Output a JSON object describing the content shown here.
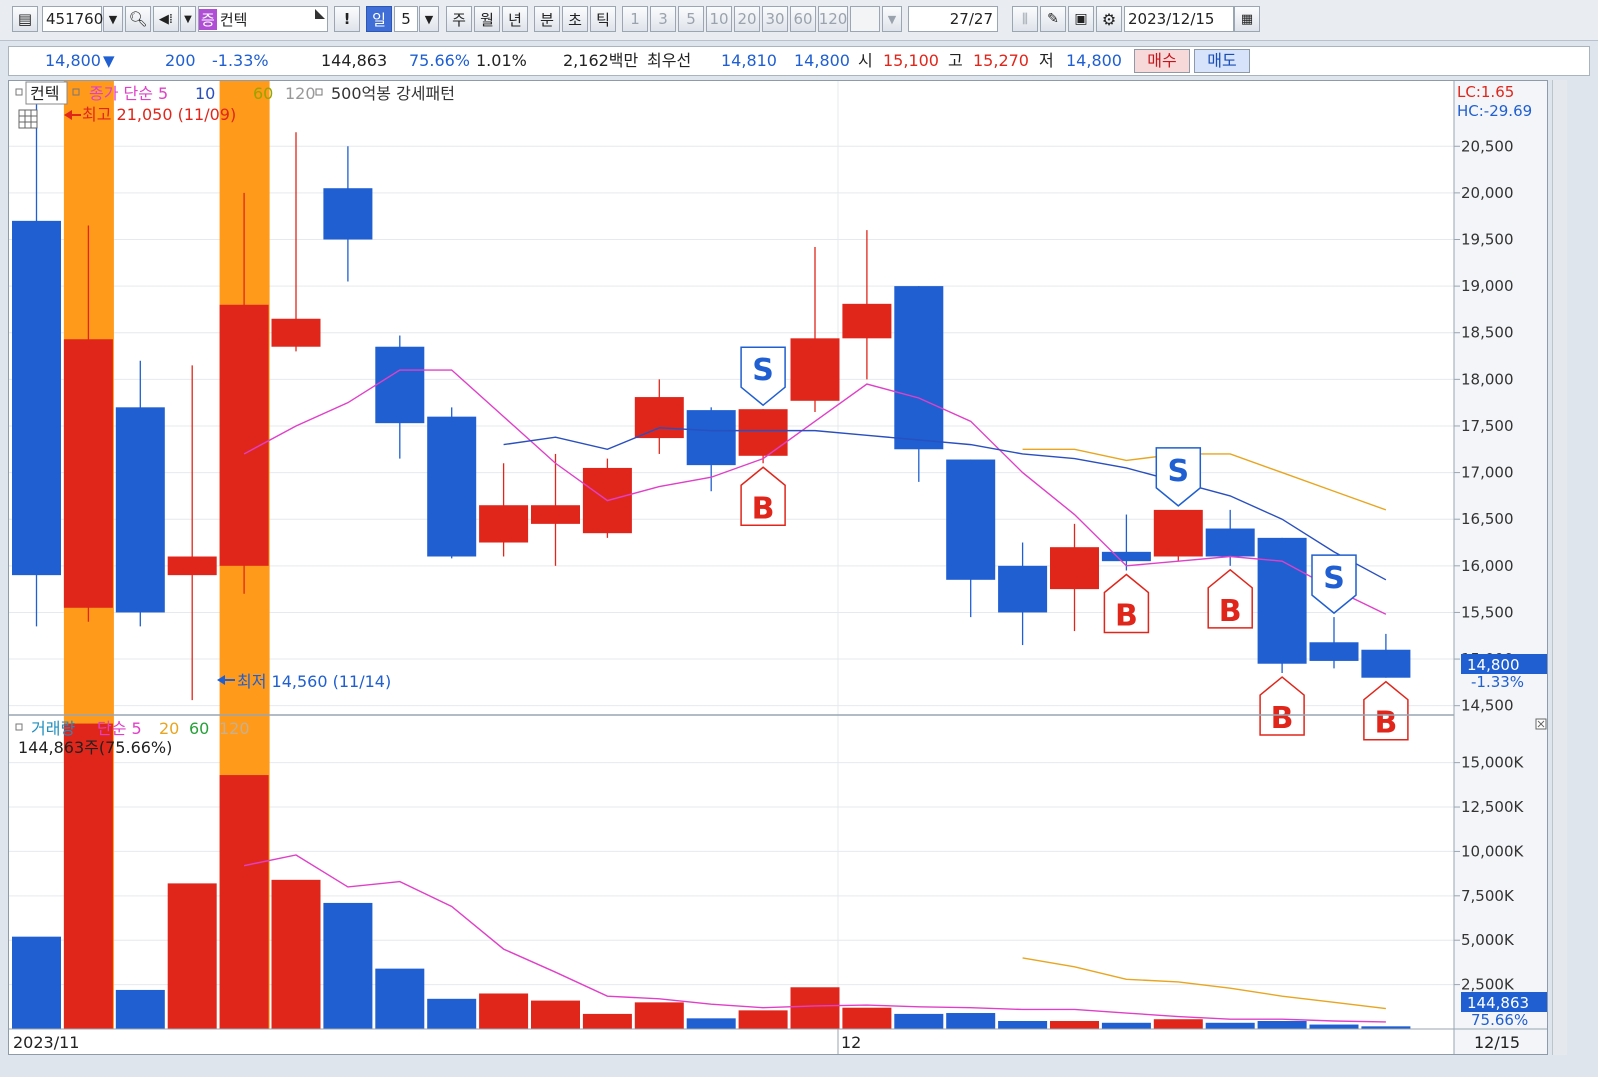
{
  "toolbar": {
    "code": "451760",
    "stock_name": "컨텍",
    "badge": "증",
    "alert": "!",
    "period_day": "일",
    "period_value": "5",
    "period_week": "주",
    "period_month": "월",
    "period_year": "년",
    "period_minute": "분",
    "period_second": "초",
    "period_tick": "틱",
    "intervals": [
      "1",
      "3",
      "5",
      "10",
      "20",
      "30",
      "60",
      "120"
    ],
    "page": "27/27",
    "date": "2023/12/15",
    "icons": [
      "search-icon",
      "speaker-icon",
      "chevron-down-icon",
      "bars-icon",
      "pencil-icon",
      "save-icon",
      "gear-icon",
      "calendar-icon"
    ]
  },
  "quote": {
    "price": "14,800",
    "arrow": "▼",
    "change": "200",
    "change_pct": "-1.33%",
    "volume": "144,863",
    "vol_ratio": "75.66%",
    "turnover": "1.01%",
    "amount": "2,162백만",
    "best_label": "최우선",
    "best_ask": "14,810",
    "best_bid": "14,800",
    "open_label": "시",
    "open": "15,100",
    "high_label": "고",
    "high": "15,270",
    "low_label": "저",
    "low": "14,800",
    "buy_label": "매수",
    "sell_label": "매도"
  },
  "price_panel": {
    "legend_name": "컨텍",
    "legend_ma": "종가 단순 5",
    "legend_10": "10",
    "legend_60": "60",
    "legend_120": "120",
    "legend_pattern": "500억봉 강세패턴",
    "max_label": "최고 21,050 (11/09)",
    "min_label": "최저 14,560 (11/14)",
    "lc_label": "LC:1.65",
    "hc_label": "HC:-29.69",
    "current_price": "14,800",
    "current_pct": "-1.33%",
    "y_ticks": [
      "20,500",
      "20,000",
      "19,500",
      "19,000",
      "18,500",
      "18,000",
      "17,500",
      "17,000",
      "16,500",
      "16,000",
      "15,500",
      "15,000",
      "14,500"
    ]
  },
  "volume_panel": {
    "legend_name": "거래량",
    "legend_ma": "단순 5",
    "legend_20": "20",
    "legend_60": "60",
    "legend_120": "120",
    "vol_label": "144,863주(75.66%)",
    "current_volume": "144,863",
    "current_pct": "75.66%",
    "y_ticks": [
      "15,000K",
      "12,500K",
      "10,000K",
      "7,500K",
      "5,000K",
      "2,500K"
    ]
  },
  "x_axis": {
    "start": "2023/11",
    "mid": "12",
    "end": "12/15"
  },
  "colors": {
    "up": "#e0261b",
    "down": "#1f5fd1",
    "highlight": "#ff9a1a",
    "ma5": "#e040c8",
    "ma10": "#2a4fbf",
    "ma20": "#e8a520"
  },
  "chart_data": {
    "type": "candlestick",
    "candles": [
      {
        "o": 19700,
        "c": 15900,
        "h": 21050,
        "l": 15350
      },
      {
        "o": 15550,
        "c": 18430,
        "h": 19650,
        "l": 15400
      },
      {
        "o": 17700,
        "c": 15500,
        "h": 18200,
        "l": 15350
      },
      {
        "o": 15900,
        "c": 16100,
        "h": 18150,
        "l": 14560
      },
      {
        "o": 16000,
        "c": 18800,
        "h": 20000,
        "l": 15700
      },
      {
        "o": 18350,
        "c": 18650,
        "h": 20650,
        "l": 18300
      },
      {
        "o": 20050,
        "c": 19500,
        "h": 20500,
        "l": 19050
      },
      {
        "o": 18350,
        "c": 17530,
        "h": 18470,
        "l": 17150
      },
      {
        "o": 17600,
        "c": 16100,
        "h": 17700,
        "l": 16080
      },
      {
        "o": 16250,
        "c": 16650,
        "h": 17100,
        "l": 16100
      },
      {
        "o": 16450,
        "c": 16650,
        "h": 17200,
        "l": 16000
      },
      {
        "o": 16350,
        "c": 17050,
        "h": 17150,
        "l": 16300
      },
      {
        "o": 17370,
        "c": 17810,
        "h": 18000,
        "l": 17200
      },
      {
        "o": 17670,
        "c": 17080,
        "h": 17700,
        "l": 16800
      },
      {
        "o": 17180,
        "c": 17680,
        "h": 17680,
        "l": 17100
      },
      {
        "o": 17770,
        "c": 18440,
        "h": 19420,
        "l": 17650
      },
      {
        "o": 18440,
        "c": 18810,
        "h": 19600,
        "l": 18000
      },
      {
        "o": 19000,
        "c": 17250,
        "h": 19000,
        "l": 16900
      },
      {
        "o": 17140,
        "c": 15850,
        "h": 17140,
        "l": 15450
      },
      {
        "o": 16000,
        "c": 15500,
        "h": 16250,
        "l": 15150
      },
      {
        "o": 15750,
        "c": 16200,
        "h": 16450,
        "l": 15300
      },
      {
        "o": 16150,
        "c": 16050,
        "h": 16550,
        "l": 15950
      },
      {
        "o": 16100,
        "c": 16600,
        "h": 16600,
        "l": 16050
      },
      {
        "o": 16400,
        "c": 16100,
        "h": 16600,
        "l": 16000
      },
      {
        "o": 16300,
        "c": 14950,
        "h": 16300,
        "l": 14850
      },
      {
        "o": 15180,
        "c": 14980,
        "h": 15450,
        "l": 14900
      },
      {
        "o": 15100,
        "c": 14800,
        "h": 15270,
        "l": 14800
      }
    ],
    "volume_k": [
      5200,
      17200,
      2200,
      8200,
      14300,
      8400,
      7100,
      3400,
      1700,
      2000,
      1600,
      850,
      1500,
      600,
      1050,
      2350,
      1200,
      850,
      900,
      450,
      450,
      350,
      550,
      350,
      450,
      250,
      150
    ],
    "ma5": [
      null,
      null,
      null,
      null,
      17200,
      17500,
      17750,
      18100,
      18100,
      17600,
      17100,
      16700,
      16850,
      16950,
      17150,
      17550,
      17950,
      17800,
      17550,
      17000,
      16550,
      16000,
      16050,
      16100,
      16050,
      15750,
      15480
    ],
    "ma10": [
      null,
      null,
      null,
      null,
      null,
      null,
      null,
      null,
      null,
      17300,
      17380,
      17250,
      17480,
      17450,
      17450,
      17450,
      17400,
      17350,
      17300,
      17200,
      17150,
      17050,
      16900,
      16750,
      16500,
      16150,
      15850
    ],
    "ma20": [
      null,
      null,
      null,
      null,
      null,
      null,
      null,
      null,
      null,
      null,
      null,
      null,
      null,
      null,
      null,
      null,
      null,
      null,
      null,
      17250,
      17250,
      17130,
      17200,
      17200,
      17000,
      16800,
      16600
    ],
    "vol_ma5": [
      null,
      null,
      null,
      null,
      9200,
      9800,
      8000,
      8300,
      6900,
      4500,
      3200,
      1850,
      1700,
      1400,
      1200,
      1300,
      1350,
      1250,
      1200,
      1100,
      1100,
      900,
      700,
      550,
      550,
      450,
      400
    ],
    "vol_ma20": [
      null,
      null,
      null,
      null,
      null,
      null,
      null,
      null,
      null,
      null,
      null,
      null,
      null,
      null,
      null,
      null,
      null,
      null,
      null,
      4000,
      3500,
      2800,
      2650,
      2300,
      1850,
      1500,
      1150
    ],
    "highlight_indices": [
      1,
      4
    ],
    "signals": [
      {
        "i": 14,
        "type": "S"
      },
      {
        "i": 14,
        "type": "B"
      },
      {
        "i": 21,
        "type": "B"
      },
      {
        "i": 22,
        "type": "S"
      },
      {
        "i": 23,
        "type": "B"
      },
      {
        "i": 24,
        "type": "B"
      },
      {
        "i": 25,
        "type": "S"
      },
      {
        "i": 26,
        "type": "B"
      }
    ],
    "price_range": [
      14400,
      21200
    ],
    "volume_range": [
      0,
      16500
    ]
  }
}
